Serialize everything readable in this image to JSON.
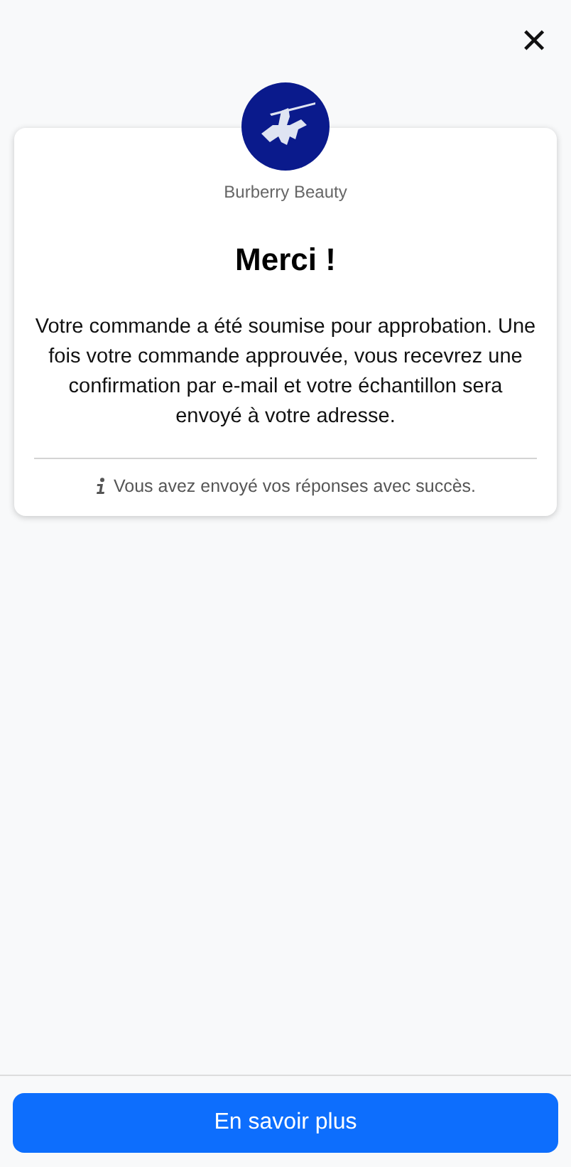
{
  "close_button": {
    "label": "✕"
  },
  "card": {
    "brand": "Burberry Beauty",
    "title": "Merci !",
    "message": "Votre commande a été soumise pour approbation. Une fois votre commande approuvée, vous recevrez une confirmation par e-mail et votre échantillon sera envoyé à votre adresse.",
    "note": "Vous avez envoyé vos réponses avec succès."
  },
  "footer": {
    "button": "En savoir plus"
  }
}
